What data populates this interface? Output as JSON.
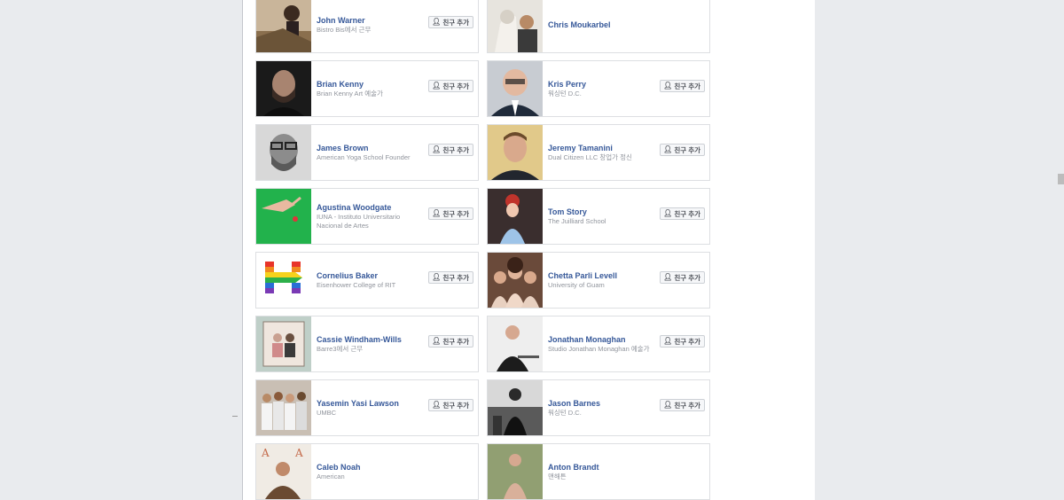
{
  "button_label": "친구 추가",
  "people": [
    {
      "name": "John Warner",
      "subtitle": "Bistro Bis에서 근무",
      "has_button": true
    },
    {
      "name": "Chris Moukarbel",
      "subtitle": "",
      "has_button": false
    },
    {
      "name": "Brian Kenny",
      "subtitle": "Brian Kenny Art 예술가",
      "has_button": true
    },
    {
      "name": "Kris Perry",
      "subtitle": "워싱턴 D.C.",
      "has_button": true
    },
    {
      "name": "James Brown",
      "subtitle": "American Yoga School Founder",
      "has_button": true
    },
    {
      "name": "Jeremy Tamanini",
      "subtitle": "Dual Citizen LLC 창업가 정신",
      "has_button": true
    },
    {
      "name": "Agustina Woodgate",
      "subtitle": "IUNA - Instituto Universitario Nacional de Artes",
      "has_button": true
    },
    {
      "name": "Tom Story",
      "subtitle": "The Juilliard School",
      "has_button": true
    },
    {
      "name": "Cornelius Baker",
      "subtitle": "Eisenhower College of RIT",
      "has_button": true
    },
    {
      "name": "Chetta Parli Levell",
      "subtitle": "University of Guam",
      "has_button": true
    },
    {
      "name": "Cassie Windham-Wills",
      "subtitle": "Barre3에서 근무",
      "has_button": true
    },
    {
      "name": "Jonathan Monaghan",
      "subtitle": "Studio Jonathan Monaghan 예술가",
      "has_button": true
    },
    {
      "name": "Yasemin Yasi Lawson",
      "subtitle": "UMBC",
      "has_button": true
    },
    {
      "name": "Jason Barnes",
      "subtitle": "워싱턴 D.C.",
      "has_button": true
    },
    {
      "name": "Caleb Noah",
      "subtitle": "American",
      "has_button": false
    },
    {
      "name": "Anton Brandt",
      "subtitle": "맨해튼",
      "has_button": false
    }
  ]
}
